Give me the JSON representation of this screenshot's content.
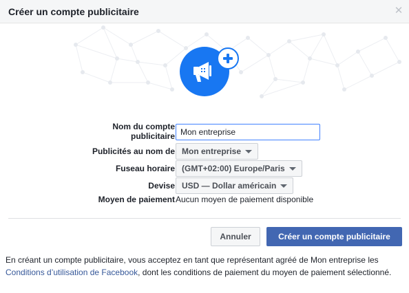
{
  "dialog": {
    "title": "Créer un compte publicitaire",
    "close_icon": "close-icon",
    "hero_icon": "megaphone-plus-icon",
    "accent_color": "#1877f2"
  },
  "form": {
    "account_name_label_line1": "Nom du compte",
    "account_name_label_line2": "publicitaire",
    "account_name_value": "Mon entreprise",
    "ads_on_behalf_label": "Publicités au nom de",
    "ads_on_behalf_value": "Mon entreprise",
    "timezone_label": "Fuseau horaire",
    "timezone_value": "(GMT+02:00) Europe/Paris",
    "currency_label": "Devise",
    "currency_value": "USD — Dollar américain",
    "payment_label": "Moyen de paiement",
    "payment_value": "Aucun moyen de paiement disponible"
  },
  "actions": {
    "cancel_label": "Annuler",
    "create_label": "Créer un compte publicitaire",
    "primary_color": "#4267b2"
  },
  "footer": {
    "text_before_link": "En créant un compte publicitaire, vous acceptez en tant que représentant agréé de Mon entreprise les ",
    "link_text": "Conditions d’utilisation de Facebook",
    "text_after_link": ", dont les conditions de paiement du moyen de paiement sélectionné."
  }
}
